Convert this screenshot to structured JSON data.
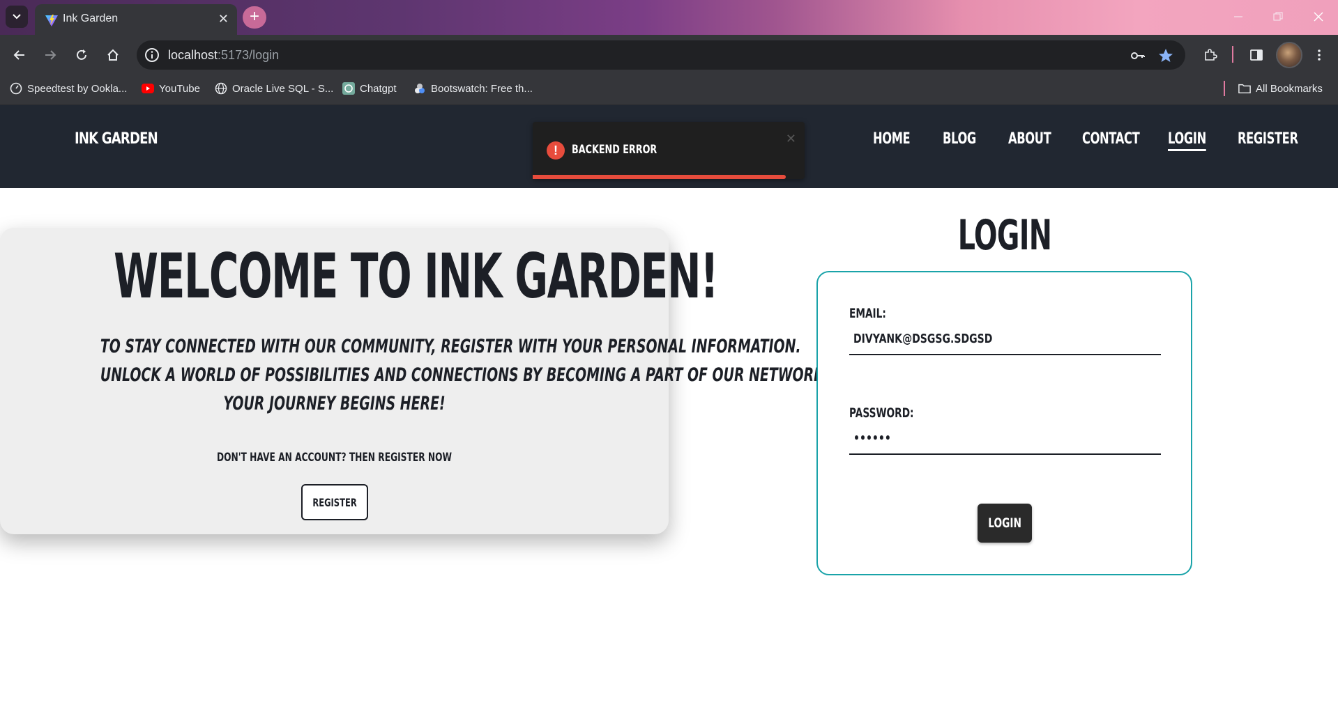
{
  "browser": {
    "tab_title": "Ink Garden",
    "url_host": "localhost",
    "url_path": ":5173/login",
    "bookmarks": [
      {
        "label": "Speedtest by Ookla...",
        "icon": "speedtest-icon"
      },
      {
        "label": "YouTube",
        "icon": "youtube-icon"
      },
      {
        "label": "Oracle Live SQL - S...",
        "icon": "globe-icon"
      },
      {
        "label": "Chatgpt",
        "icon": "chatgpt-icon"
      },
      {
        "label": "Bootswatch: Free th...",
        "icon": "bootswatch-icon"
      }
    ],
    "all_bookmarks_label": "All Bookmarks"
  },
  "site": {
    "brand": "INK GARDEN",
    "nav": [
      "HOME",
      "BLOG",
      "ABOUT",
      "CONTACT",
      "LOGIN",
      "REGISTER"
    ],
    "active_nav": "LOGIN"
  },
  "toast": {
    "message": "BACKEND ERROR",
    "type": "error",
    "color": "#e74c3c",
    "progress": 0.93
  },
  "welcome": {
    "title": "WELCOME TO INK GARDEN!",
    "lines": [
      "TO STAY CONNECTED WITH OUR COMMUNITY, REGISTER WITH YOUR PERSONAL INFORMATION.",
      "UNLOCK A WORLD OF POSSIBILITIES AND CONNECTIONS BY BECOMING A PART OF OUR NETWORK.",
      "YOUR JOURNEY BEGINS HERE!"
    ],
    "prompt": "DON'T HAVE AN ACCOUNT? THEN REGISTER NOW",
    "register_button": "REGISTER"
  },
  "login": {
    "heading": "LOGIN",
    "email_label": "EMAIL:",
    "email_value": "DIVYANK@DSGSG.SDGSD",
    "password_label": "PASSWORD:",
    "password_value": "••••••",
    "button": "LOGIN"
  },
  "colors": {
    "navbar": "#212731",
    "card_border": "#1aa3a9",
    "error": "#e74c3c"
  }
}
